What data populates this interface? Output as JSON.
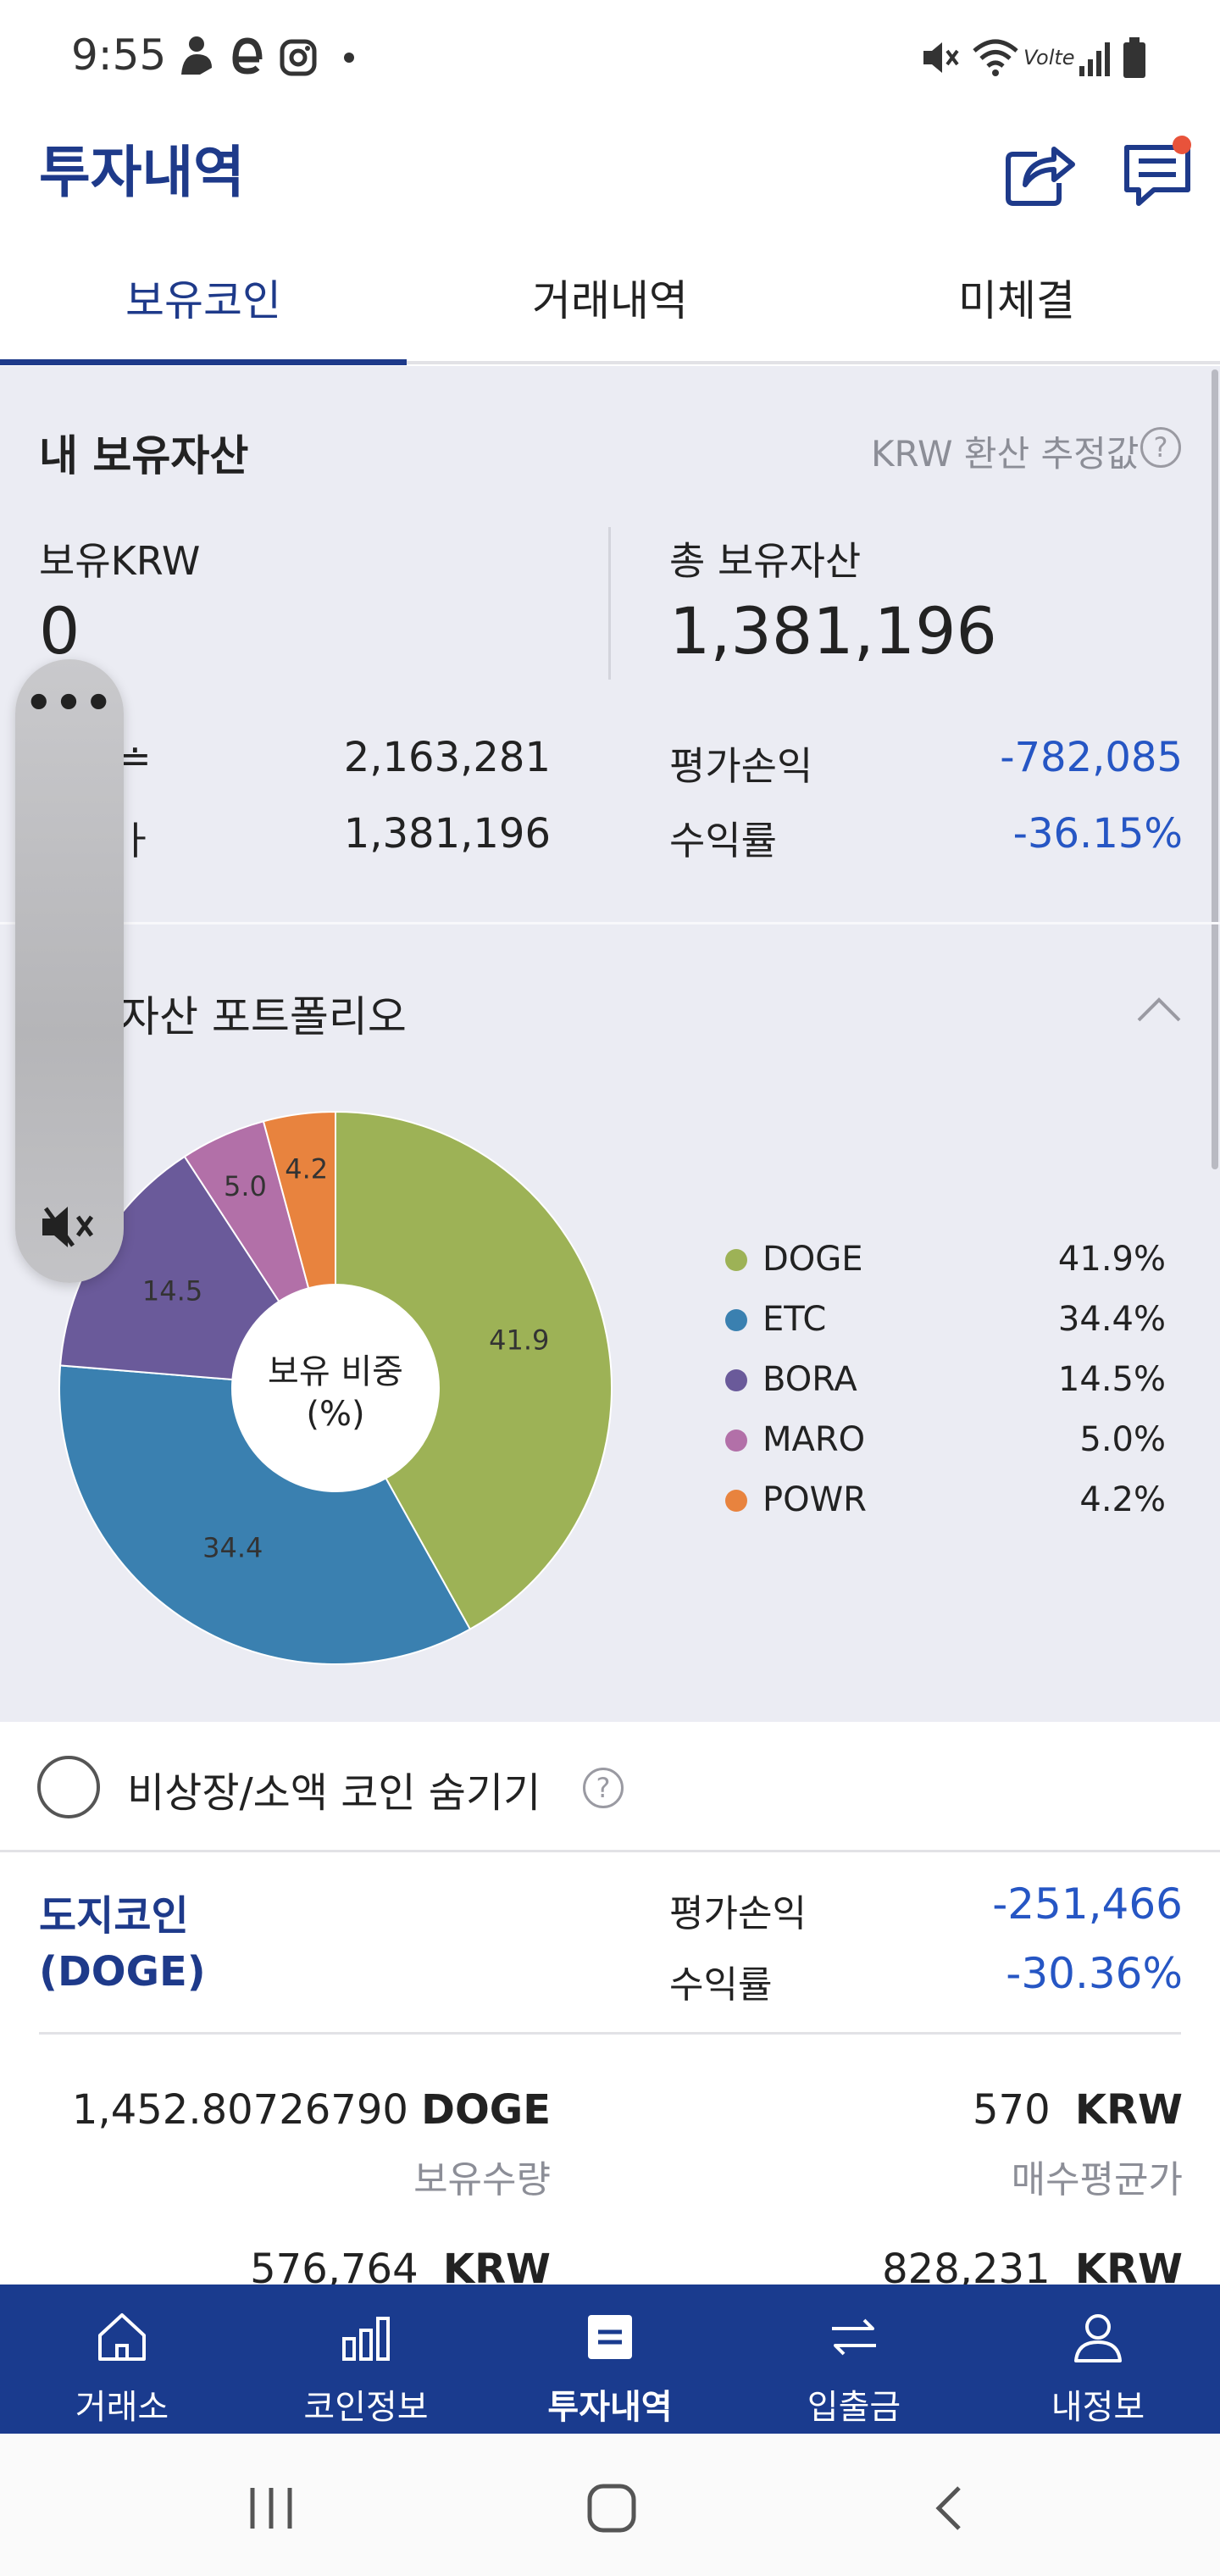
{
  "status_bar": {
    "time": "9:55",
    "icons": [
      "person-icon",
      "e-app-icon",
      "instagram-icon",
      "dot-icon",
      "mute-icon",
      "wifi-icon",
      "volte-icon",
      "signal-icon",
      "battery-icon"
    ],
    "volte_label": "Volte"
  },
  "header": {
    "title": "투자내역",
    "icons": [
      "share-icon",
      "chat-icon"
    ]
  },
  "tabs": [
    {
      "label": "보유코인",
      "active": true
    },
    {
      "label": "거래내역",
      "active": false
    },
    {
      "label": "미체결",
      "active": false
    }
  ],
  "assets": {
    "title": "내 보유자산",
    "krw_note": "KRW 환산 추정값",
    "krw_label": "보유KRW",
    "krw_value": "0",
    "total_label": "총 보유자산",
    "total_value": "1,381,196",
    "row1_label_partial": "≐",
    "row1_value": "2,163,281",
    "row2_label_partial": "ㅏ",
    "row2_value": "1,381,196",
    "pnl_label": "평가손익",
    "pnl_value": "-782,085",
    "rate_label": "수익률",
    "rate_value": "-36.15%"
  },
  "portfolio": {
    "title": "자산 포트폴리오",
    "center_line1": "보유 비중",
    "center_line2": "(%)"
  },
  "chart_data": {
    "type": "pie",
    "categories": [
      "DOGE",
      "ETC",
      "BORA",
      "MARO",
      "POWR"
    ],
    "values": [
      41.9,
      34.4,
      14.5,
      5.0,
      4.2
    ],
    "slice_labels": [
      "41.9",
      "34.4",
      "14.5",
      "5.0",
      "4.2"
    ],
    "legend_pcts": [
      "41.9%",
      "34.4%",
      "14.5%",
      "5.0%",
      "4.2%"
    ],
    "colors": [
      "#9db256",
      "#3a80b0",
      "#6a5a9a",
      "#b270a8",
      "#e8833e"
    ],
    "title": "",
    "legend_placement": "right"
  },
  "hide_small": {
    "label": "비상장/소액 코인 숨기기"
  },
  "coin": {
    "name_line1": "도지코인",
    "name_line2": "(DOGE)",
    "pnl_label": "평가손익",
    "pnl_value": "-251,466",
    "rate_label": "수익률",
    "rate_value": "-30.36%",
    "qty_value": "1,452.80726790",
    "qty_unit": "DOGE",
    "qty_label": "보유수량",
    "avg_value": "570",
    "avg_unit": "KRW",
    "avg_label": "매수평균가",
    "eval_value": "576,764",
    "eval_unit": "KRW",
    "buy_value": "828,231",
    "buy_unit": "KRW"
  },
  "bottom_nav": [
    {
      "label": "거래소",
      "icon": "home-icon",
      "active": false
    },
    {
      "label": "코인정보",
      "icon": "bar-chart-icon",
      "active": false
    },
    {
      "label": "투자내역",
      "icon": "list-icon",
      "active": true
    },
    {
      "label": "입출금",
      "icon": "transfer-icon",
      "active": false
    },
    {
      "label": "내정보",
      "icon": "person-icon",
      "active": false
    }
  ]
}
